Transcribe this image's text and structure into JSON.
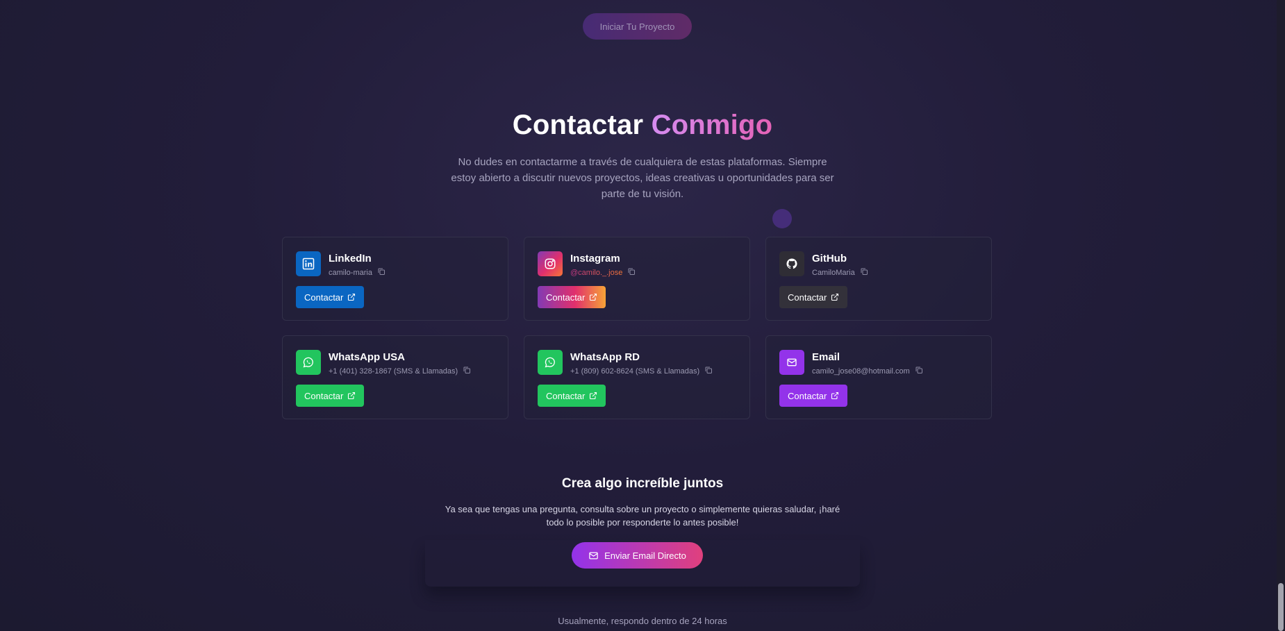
{
  "hero": {
    "cta_label": "Iniciar Tu Proyecto"
  },
  "contact": {
    "title_main": "Contactar",
    "title_accent": "Conmigo",
    "intro": "No dudes en contactarme a través de cualquiera de estas plataformas. Siempre estoy abierto a discutir nuevos proyectos, ideas creativas u oportunidades para ser parte de tu visión.",
    "cards": [
      {
        "name": "LinkedIn",
        "handle": "camilo-maria",
        "button": "Contactar",
        "icon": "linkedin-icon",
        "color": "#0a66c2"
      },
      {
        "name": "Instagram",
        "handle": "@camilo._.jose",
        "button": "Contactar",
        "icon": "instagram-icon",
        "color": "#e1306c"
      },
      {
        "name": "GitHub",
        "handle": "CamiloMaria",
        "button": "Contactar",
        "icon": "github-icon",
        "color": "#2f2d35"
      },
      {
        "name": "WhatsApp USA",
        "handle": "+1 (401) 328-1867 (SMS & Llamadas)",
        "button": "Contactar",
        "icon": "whatsapp-icon",
        "color": "#22c55e"
      },
      {
        "name": "WhatsApp RD",
        "handle": "+1 (809) 602-8624 (SMS & Llamadas)",
        "button": "Contactar",
        "icon": "whatsapp-icon",
        "color": "#22c55e"
      },
      {
        "name": "Email",
        "handle": "camilo_jose08@hotmail.com",
        "button": "Contactar",
        "icon": "mail-icon",
        "color": "#9333ea"
      }
    ]
  },
  "collab": {
    "title": "Crea algo increíble juntos",
    "text": "Ya sea que tengas una pregunta, consulta sobre un proyecto o simplemente quieras saludar, ¡haré todo lo posible por responderte lo antes posible!",
    "button": "Enviar Email Directo"
  },
  "footer": {
    "note": "Usualmente, respondo dentro de 24 horas"
  }
}
